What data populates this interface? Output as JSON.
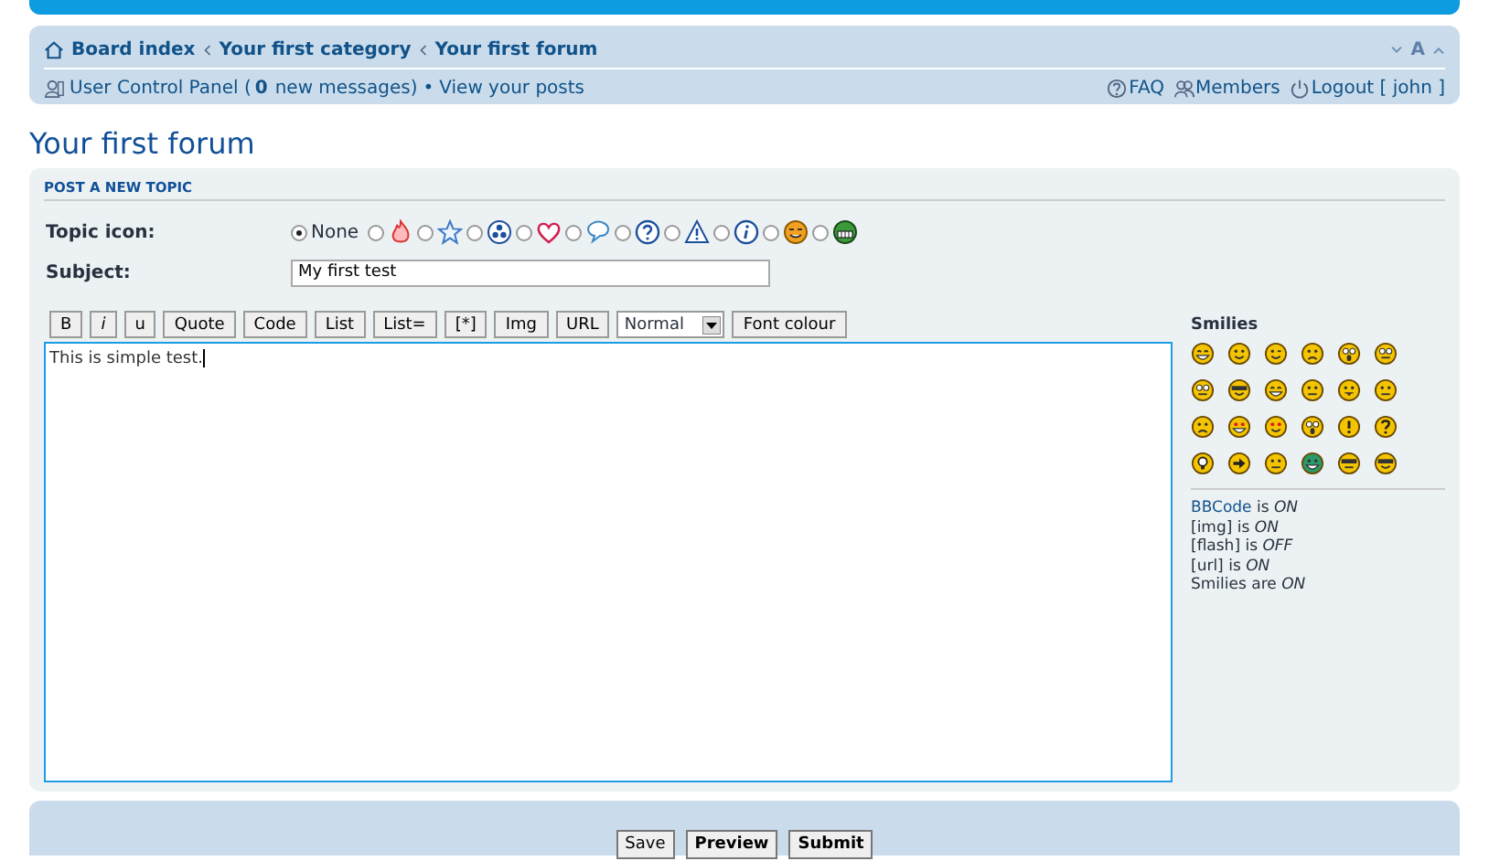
{
  "breadcrumbs": [
    {
      "label": "Board index"
    },
    {
      "label": "Your first category"
    },
    {
      "label": "Your first forum"
    }
  ],
  "font_size_toggle": "A",
  "user_links": {
    "ucp": "User Control Panel (",
    "count": "0",
    "messages": "new messages)",
    "separator": "•",
    "view_posts": "View your posts"
  },
  "top_links": [
    {
      "kind": "faq",
      "label": "FAQ"
    },
    {
      "kind": "members",
      "label": "Members"
    },
    {
      "kind": "logout",
      "label": "Logout [ john ]"
    }
  ],
  "page_title": "Your first forum",
  "form": {
    "section_title": "POST A NEW TOPIC",
    "topic_icon_label": "Topic icon:",
    "subject_label": "Subject:",
    "subject_value": "My first test",
    "topic_icons": [
      {
        "kind": "none",
        "label": "None",
        "selected": true
      },
      {
        "kind": "fire",
        "selected": false
      },
      {
        "kind": "star",
        "selected": false
      },
      {
        "kind": "radioactive",
        "selected": false
      },
      {
        "kind": "heart",
        "selected": false
      },
      {
        "kind": "speech",
        "selected": false
      },
      {
        "kind": "question",
        "selected": false
      },
      {
        "kind": "warning",
        "selected": false
      },
      {
        "kind": "info",
        "selected": false
      },
      {
        "kind": "wink",
        "selected": false
      },
      {
        "kind": "grin",
        "selected": false
      }
    ],
    "format_buttons": [
      {
        "kind": "button",
        "label": "B"
      },
      {
        "kind": "button",
        "label": "i"
      },
      {
        "kind": "button",
        "label": "u"
      },
      {
        "kind": "button",
        "label": "Quote"
      },
      {
        "kind": "button",
        "label": "Code"
      },
      {
        "kind": "button",
        "label": "List"
      },
      {
        "kind": "button",
        "label": "List="
      },
      {
        "kind": "button",
        "label": "[*]"
      },
      {
        "kind": "button",
        "label": "Img"
      },
      {
        "kind": "button",
        "label": "URL"
      },
      {
        "kind": "select",
        "label": "Normal"
      },
      {
        "kind": "button",
        "label": "Font colour"
      }
    ],
    "message": "This is simple test.",
    "smilies_title": "Smilies",
    "smilies": [
      {
        "kind": "laugh"
      },
      {
        "kind": "smile"
      },
      {
        "kind": "wink"
      },
      {
        "kind": "sad"
      },
      {
        "kind": "surprise"
      },
      {
        "kind": "eek"
      },
      {
        "kind": "rolleyes"
      },
      {
        "kind": "cool"
      },
      {
        "kind": "happy"
      },
      {
        "kind": "confused"
      },
      {
        "kind": "razz"
      },
      {
        "kind": "neutral"
      },
      {
        "kind": "cry"
      },
      {
        "kind": "evil"
      },
      {
        "kind": "twisted"
      },
      {
        "kind": "shock"
      },
      {
        "kind": "exclaim"
      },
      {
        "kind": "question"
      },
      {
        "kind": "idea"
      },
      {
        "kind": "arrow"
      },
      {
        "kind": "neutral"
      },
      {
        "kind": "green"
      },
      {
        "kind": "geek"
      },
      {
        "kind": "ubergeek"
      }
    ],
    "bbcode_link": "BBCode",
    "bbcode_state": "is *ON*",
    "options": [
      "[img] is *ON*",
      "[flash] is *OFF*",
      "[url] is *ON*",
      "Smilies are *ON*"
    ],
    "actions": [
      "Save",
      "Preview",
      "Submit"
    ]
  }
}
